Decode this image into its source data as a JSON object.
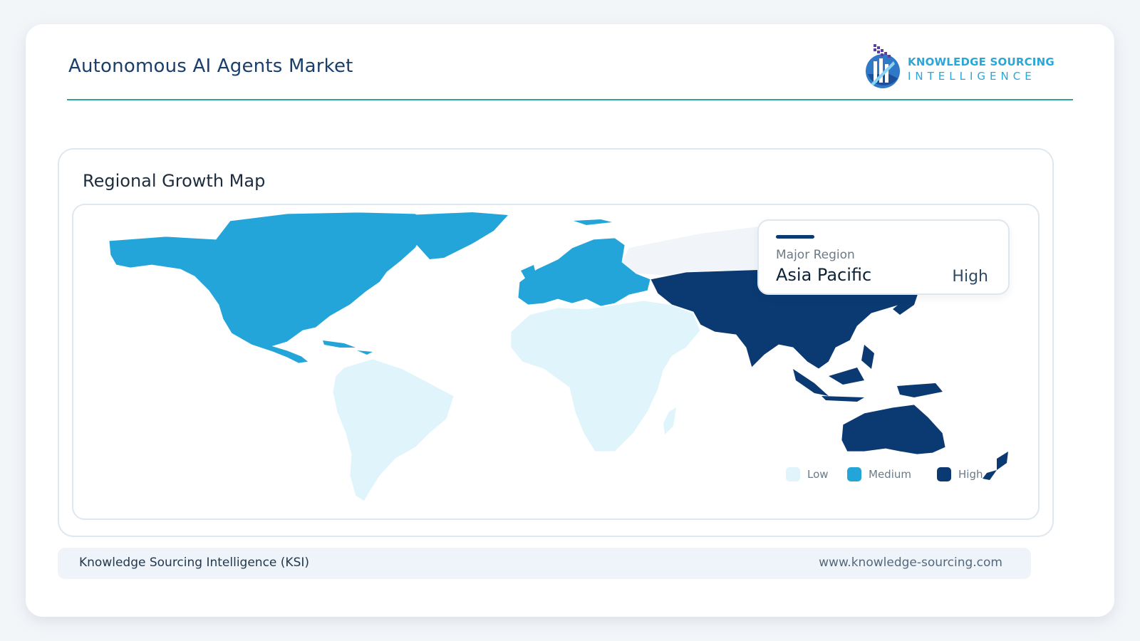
{
  "header": {
    "title": "Autonomous AI Agents Market",
    "logo_line1": "KNOWLEDGE SOURCING",
    "logo_line2": "INTELLIGENCE"
  },
  "panel": {
    "title": "Regional Growth Map"
  },
  "tooltip": {
    "label": "Major Region",
    "region": "Asia Pacific",
    "level": "High"
  },
  "legend": [
    {
      "label": "Low",
      "color": "#dff5fb"
    },
    {
      "label": "Medium",
      "color": "#24a5da"
    },
    {
      "label": "High",
      "color": "#0b3a73"
    }
  ],
  "regions": [
    {
      "name": "North America",
      "level": "Medium"
    },
    {
      "name": "South America",
      "level": "Low"
    },
    {
      "name": "Europe",
      "level": "Medium"
    },
    {
      "name": "Middle East and Africa",
      "level": "Low"
    },
    {
      "name": "Asia Pacific",
      "level": "High"
    }
  ],
  "footer": {
    "left": "Knowledge Sourcing Intelligence (KSI)",
    "right": "www.knowledge-sourcing.com"
  }
}
